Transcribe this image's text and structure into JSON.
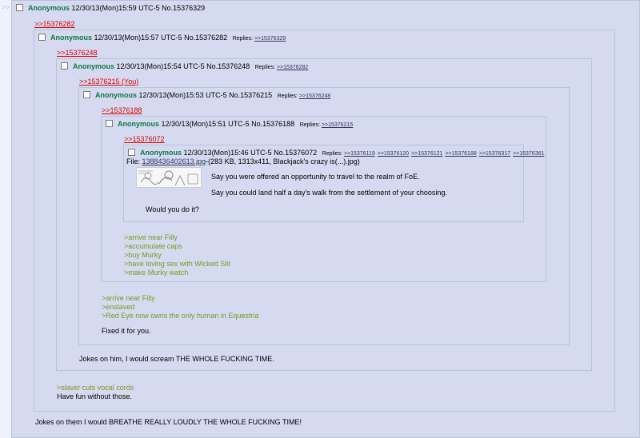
{
  "posts": [
    {
      "name": "Anonymous",
      "datetime": "12/30/13(Mon)15:59 UTC-5",
      "number": "No.15376329",
      "quote": ">>15376282",
      "body": [
        "Jokes on them I would BREATHE REALLY LOUDLY THE WHOLE FUCKING TIME!"
      ]
    },
    {
      "name": "Anonymous",
      "datetime": "12/30/13(Mon)15:57 UTC-5",
      "number": "No.15376282",
      "replies_label": "Replies:",
      "replies": [
        ">>15376329"
      ],
      "quote": ">>15376248",
      "green": [
        ">slaver cuts vocal cords"
      ],
      "body": [
        "Have fun without those."
      ]
    },
    {
      "name": "Anonymous",
      "datetime": "12/30/13(Mon)15:54 UTC-5",
      "number": "No.15376248",
      "replies_label": "Replies:",
      "replies": [
        ">>15376282"
      ],
      "quote": ">>15376215 (You)",
      "body": [
        "Jokes on him, I would scream THE WHOLE FUCKING TIME."
      ]
    },
    {
      "name": "Anonymous",
      "datetime": "12/30/13(Mon)15:53 UTC-5",
      "number": "No.15376215",
      "replies_label": "Replies:",
      "replies": [
        ">>15376248"
      ],
      "quote": ">>15376188",
      "green": [
        ">arrive near Filly",
        ">enslaved",
        ">Red Eye now owns the only human in Equestria"
      ],
      "body": [
        "Fixed it for you."
      ]
    },
    {
      "name": "Anonymous",
      "datetime": "12/30/13(Mon)15:51 UTC-5",
      "number": "No.15376188",
      "replies_label": "Replies:",
      "replies": [
        ">>15376215"
      ],
      "quote": ">>15376072",
      "green": [
        ">arrive near Filly",
        ">accumulate caps",
        ">buy Murky",
        ">have loving sex with Wicked Slit",
        ">make Murky watch"
      ]
    },
    {
      "name": "Anonymous",
      "datetime": "12/30/13(Mon)15:46 UTC-5",
      "number": "No.15376072",
      "replies_label": "Replies:",
      "replies": [
        ">>15376119",
        ">>15376120",
        ">>15376121",
        ">>15376188",
        ">>15376317",
        ">>15376361"
      ],
      "file_label": "File:",
      "file_name": "1388436402613.jpg",
      "file_meta": "-(283 KB, 1313x411, Blackjack's crazy is(...).jpg)",
      "body": [
        "Say you were offered an opportunity to travel to the realm of FoE.",
        "Say you could land half a day's walk from the settlement of your choosing.",
        "Would you do it?"
      ]
    }
  ],
  "side_arrows": ">>"
}
